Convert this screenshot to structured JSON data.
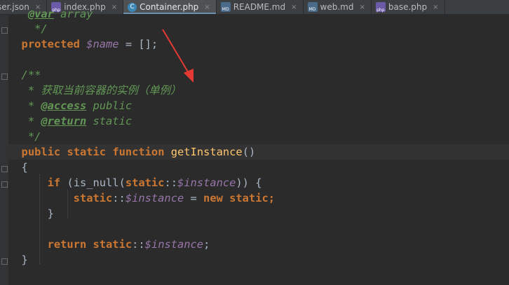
{
  "tabs": [
    {
      "label": "ser.json",
      "icon": "",
      "active": false
    },
    {
      "label": "index.php",
      "icon": "php-file-icon",
      "active": false
    },
    {
      "label": "Container.php",
      "icon": "php-class-icon",
      "active": true
    },
    {
      "label": "README.md",
      "icon": "markdown-file-icon",
      "active": false
    },
    {
      "label": "web.md",
      "icon": "markdown-file-icon",
      "active": false
    },
    {
      "label": "base.php",
      "icon": "php-file-icon",
      "active": false
    }
  ],
  "close_glyph": "×",
  "code": {
    "l0_var_tag": "@var",
    "l0_type": " array",
    "l1_end": " */",
    "l2_kw": "protected",
    "l2_var": "$name",
    "l2_rest": " = [];",
    "l4_open": "/**",
    "l5_star": " * ",
    "l5_text": "获取当前容器的实例（单例）",
    "l6_tag": "@access",
    "l6_val": " public",
    "l7_tag": "@return",
    "l7_val": " static",
    "l8_end": " */",
    "l9_kw1": "public",
    "l9_kw2": "static",
    "l9_kw3": "function",
    "l9_fn": "getInstance",
    "l9_paren": "()",
    "l10_brace": "{",
    "l11_kw": "if",
    "l11_call": "(is_null(",
    "l11_static": "static",
    "l11_colons": "::",
    "l11_var": "$instance",
    "l11_close": ")) {",
    "l12_static": "static",
    "l12_colons": "::",
    "l12_var": "$instance",
    "l12_eq": " = ",
    "l12_new": "new",
    "l12_static2": "static",
    "l12_semi": ";",
    "l13_brace": "}",
    "l15_return": "return",
    "l15_static": "static",
    "l15_colons": "::",
    "l15_var": "$instance",
    "l15_semi": ";",
    "l16_brace": "}"
  },
  "colors": {
    "background": "#2b2b2b",
    "keyword": "#cc7832",
    "variable": "#9876aa",
    "doc_comment": "#629755",
    "function": "#ffc66d",
    "annotation_arrow": "#e53935"
  }
}
